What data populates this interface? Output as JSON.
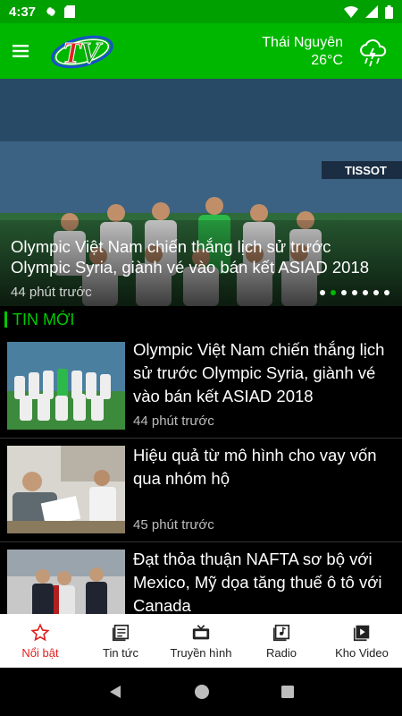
{
  "status_bar": {
    "time": "4:37",
    "icons": [
      "gear-icon",
      "sd-card-icon",
      "wifi-icon",
      "signal-icon",
      "battery-icon"
    ]
  },
  "app_bar": {
    "menu_icon": "hamburger-menu-icon",
    "logo_text": "TV",
    "weather": {
      "location": "Thái Nguyên",
      "temperature": "26°C",
      "icon": "rain-cloud-icon"
    }
  },
  "hero": {
    "title": "Olympic Việt Nam chiến thắng lịch sử trước Olympic Syria, giành vé vào bán kết ASIAD 2018",
    "time": "44 phút trước",
    "banner_text": "TISSOT",
    "slide_count": 7,
    "active_slide": 1
  },
  "section": {
    "title": "TIN MỚI"
  },
  "news": [
    {
      "title": "Olympic Việt Nam chiến thắng lịch sử trước Olympic Syria, giành vé vào bán kết ASIAD 2018",
      "time": "44 phút trước"
    },
    {
      "title": "Hiệu quả từ mô hình cho vay vốn qua nhóm hộ",
      "time": "45 phút trước"
    },
    {
      "title": "Đạt thỏa thuận NAFTA sơ bộ với Mexico, Mỹ dọa tăng thuế ô tô với Canada",
      "time": ""
    }
  ],
  "bottom_nav": [
    {
      "label": "Nổi bật",
      "icon": "star-icon",
      "active": true
    },
    {
      "label": "Tin tức",
      "icon": "news-icon",
      "active": false
    },
    {
      "label": "Truyền hình",
      "icon": "tv-icon",
      "active": false
    },
    {
      "label": "Radio",
      "icon": "radio-icon",
      "active": false
    },
    {
      "label": "Kho Video",
      "icon": "video-library-icon",
      "active": false
    }
  ],
  "colors": {
    "primary_green": "#00b700",
    "status_green": "#00a000",
    "active_nav": "#e02020",
    "section_green": "#00c800"
  }
}
